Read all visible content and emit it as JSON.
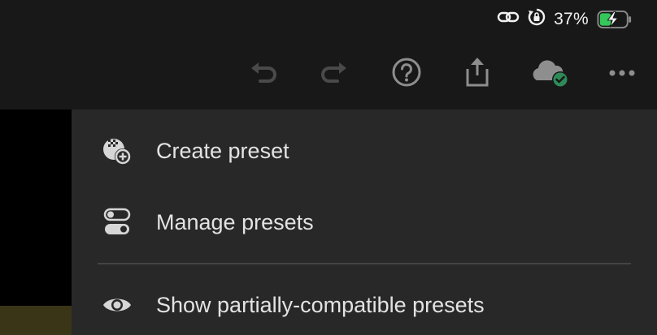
{
  "status_bar": {
    "battery_percent": "37%",
    "battery_charging": true,
    "icons": [
      "link-icon",
      "orientation-lock-icon",
      "battery-charging-icon"
    ]
  },
  "toolbar": {
    "buttons": [
      "undo-icon",
      "redo-icon",
      "help-icon",
      "share-icon",
      "cloud-synced-icon",
      "more-icon"
    ],
    "cloud_status_color": "#2e8b57"
  },
  "menu": {
    "items": [
      {
        "label": "Create preset",
        "icon": "create-preset-icon"
      },
      {
        "label": "Manage presets",
        "icon": "manage-presets-icon"
      },
      {
        "label": "Show partially-compatible presets",
        "icon": "eye-icon"
      }
    ]
  },
  "colors": {
    "background": "#181818",
    "menu_background": "#282828",
    "battery_fill": "#34c759"
  }
}
